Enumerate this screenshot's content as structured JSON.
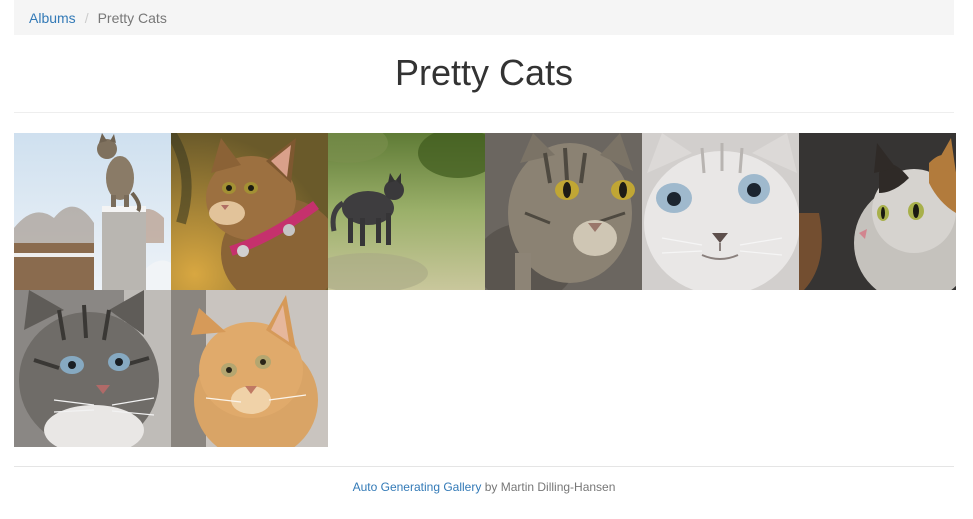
{
  "breadcrumb": {
    "items": [
      {
        "label": "Albums"
      },
      {
        "label": "Pretty Cats"
      }
    ],
    "separator": "/"
  },
  "page": {
    "title": "Pretty Cats"
  },
  "gallery": {
    "photos": [
      {
        "subject": "tabby cat standing on stone pillar in snow",
        "palette": [
          "#dfe9f3",
          "#8b7a66"
        ]
      },
      {
        "subject": "tabby kitten with pink collar",
        "palette": [
          "#b58a3d",
          "#6d4a24"
        ]
      },
      {
        "subject": "dark cat walking on grass",
        "palette": [
          "#8fa25a",
          "#3a3a3a"
        ]
      },
      {
        "subject": "tabby cat with yellow eyes close-up",
        "palette": [
          "#6f6a63",
          "#b8a98c"
        ]
      },
      {
        "subject": "white kitten with blue eyes",
        "palette": [
          "#d9d5d3",
          "#8fb2c9"
        ]
      },
      {
        "subject": "calico cat with green eyes",
        "palette": [
          "#3a3736",
          "#c98f4e"
        ]
      },
      {
        "subject": "grey tabby cat with blue eyes",
        "palette": [
          "#7b7874",
          "#c7c2bc"
        ]
      },
      {
        "subject": "ginger cat portrait",
        "palette": [
          "#cfcac5",
          "#d7a062"
        ]
      }
    ]
  },
  "footer": {
    "link_label": "Auto Generating Gallery",
    "by_text": "by Martin Dilling-Hansen"
  },
  "colors": {
    "link": "#337ab7",
    "breadcrumb_bg": "#f5f5f5",
    "muted_text": "#777777"
  }
}
